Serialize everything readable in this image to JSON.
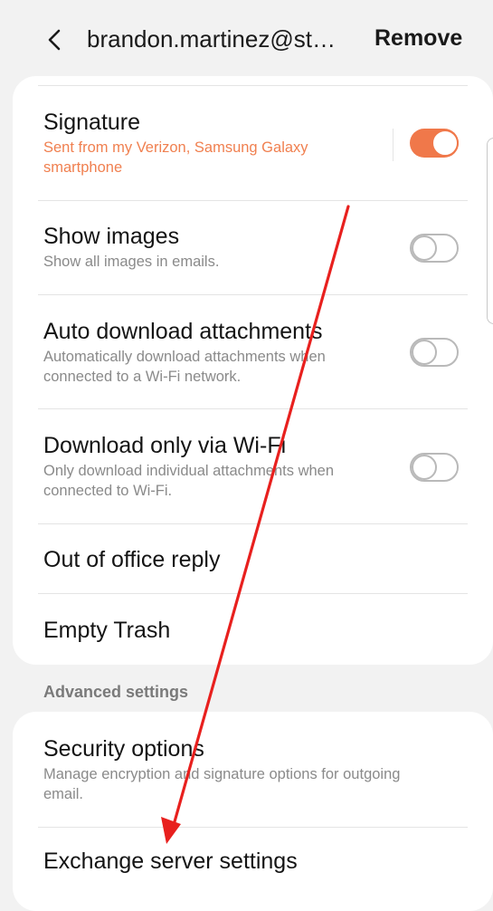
{
  "header": {
    "back_icon": "chevron-left-icon",
    "account_title": "brandon.martinez@st…",
    "remove_label": "Remove"
  },
  "settings": {
    "signature": {
      "title": "Signature",
      "summary": "Sent from my Verizon, Samsung Galaxy smartphone",
      "enabled": true
    },
    "show_images": {
      "title": "Show images",
      "summary": "Show all images in emails.",
      "enabled": false
    },
    "auto_download": {
      "title": "Auto download attachments",
      "summary": "Automatically download attachments when connected to a Wi-Fi network.",
      "enabled": false
    },
    "wifi_only": {
      "title": "Download only via Wi-Fi",
      "summary": "Only download individual attachments when connected to Wi-Fi.",
      "enabled": false
    },
    "out_of_office": {
      "title": "Out of office reply"
    },
    "empty_trash": {
      "title": "Empty Trash"
    }
  },
  "advanced": {
    "section_label": "Advanced settings",
    "security_options": {
      "title": "Security options",
      "summary": "Manage encryption and signature options for outgoing email."
    },
    "exchange_server": {
      "title": "Exchange server settings"
    }
  },
  "colors": {
    "accent": "#f0784a",
    "annotation_arrow": "#e8201e",
    "background": "#f2f2f2"
  }
}
